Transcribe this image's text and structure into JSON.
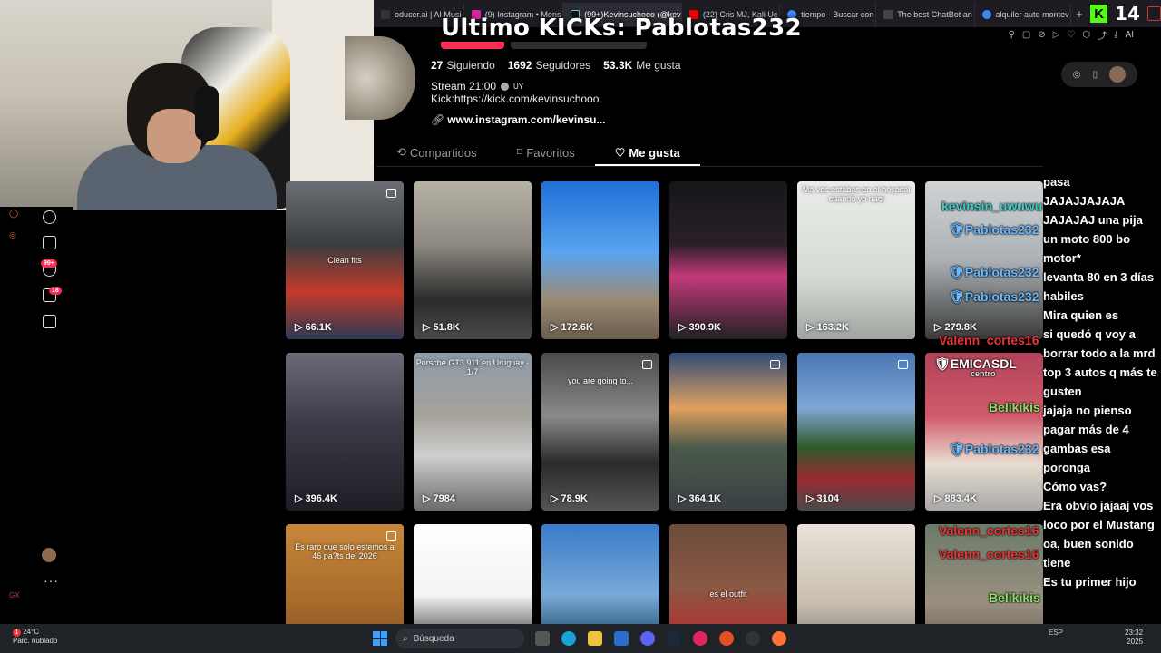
{
  "browser": {
    "tabs": [
      {
        "label": "oducer.ai | AI Musi",
        "color": "#333"
      },
      {
        "label": "(9) Instagram • Mens",
        "color": "#d6249f"
      },
      {
        "label": "(99+)Kevinsuchooo (@kev",
        "color": "#111"
      },
      {
        "label": "(22) Cris MJ, Kali Uc",
        "color": "#e00"
      },
      {
        "label": "tiempo - Buscar con",
        "color": "#4285f4"
      },
      {
        "label": "The best ChatBot an",
        "color": "#444"
      },
      {
        "label": "alquiler auto montev",
        "color": "#4285f4"
      }
    ],
    "new_tab": "+",
    "ai_label": "AI"
  },
  "stream": {
    "kick_logo": "K",
    "viewer_count": "14",
    "overlay_title": "Ultimo KICKs: Pablotas232"
  },
  "profile": {
    "following_count": "27",
    "following_label": "Siguiendo",
    "followers_count": "1692",
    "followers_label": "Seguidores",
    "likes_count": "53.3K",
    "likes_label": "Me gusta",
    "bio_line1": "Stream 21:00",
    "bio_country": "UY",
    "bio_line2": "Kick:https://kick.com/kevinsuchooo",
    "link": "www.instagram.com/kevinsu..."
  },
  "profile_tabs": [
    {
      "label": "Compartidos",
      "icon": "⟲"
    },
    {
      "label": "Favoritos",
      "icon": "⌑"
    },
    {
      "label": "Me gusta",
      "icon": "♡"
    }
  ],
  "sidebar": {
    "messages_badge": "99+",
    "inbox_badge": "18"
  },
  "videos": [
    {
      "views": "66.1K",
      "overlay": "Clean fits",
      "pinned": true,
      "bg": "linear-gradient(180deg,#6b6f74 0%,#3a3d40 40%,#c43a2a 70%,#2e3a55 100%)"
    },
    {
      "views": "51.8K",
      "overlay": "",
      "pinned": false,
      "bg": "linear-gradient(180deg,#b7b2a6 0%,#8e8a82 40%,#2b2b2b 75%,#4a4a4a 100%)"
    },
    {
      "views": "172.6K",
      "overlay": "",
      "pinned": false,
      "bg": "linear-gradient(180deg,#1f6fd6 0%,#5aa4ef 45%,#9b8b74 75%,#6b5d4c 100%)"
    },
    {
      "views": "390.9K",
      "overlay": "",
      "pinned": false,
      "bg": "linear-gradient(180deg,#16161a 0%,#2a1f28 40%,#c23a7a 60%,#222 100%)"
    },
    {
      "views": "163.2K",
      "overlay": "Ma vos estabas en el hospital cuando yo naci",
      "pinned": false,
      "bg": "linear-gradient(180deg,#e9ece8 0%,#d7dbd6 60%,#9fa4a0 100%)"
    },
    {
      "views": "279.8K",
      "overlay": "",
      "pinned": false,
      "bg": "linear-gradient(180deg,#cfd3d6 0%,#aab0b4 50%,#3a3a3a 100%)"
    },
    {
      "views": "396.4K",
      "overlay": "",
      "pinned": false,
      "bg": "linear-gradient(180deg,#6b6a78 0%,#3b3a46 45%,#1e1e26 100%)"
    },
    {
      "views": "7984",
      "overlay": "Porsche GT3 911 en Uruguay · 1/7",
      "pinned": false,
      "bg": "linear-gradient(180deg,#8d9aa8 0%,#a6a39c 40%,#cfcfcf 65%,#6c6c6c 100%)"
    },
    {
      "views": "78.9K",
      "overlay": "you are going to...",
      "pinned": true,
      "bg": "linear-gradient(180deg,#4a4a4a 0%,#8a8a8a 40%,#2a2a2a 70%,#555 100%)"
    },
    {
      "views": "364.1K",
      "overlay": "",
      "pinned": true,
      "bg": "linear-gradient(180deg,#2f4c78 0%,#e0a060 35%,#4a5a4a 60%,#3a3f45 100%)"
    },
    {
      "views": "3104",
      "overlay": "",
      "pinned": true,
      "bg": "linear-gradient(180deg,#4a78b5 0%,#7fa6d4 35%,#2e5a2a 60%,#9a2a30 80%,#4a4a4a 100%)"
    },
    {
      "views": "883.4K",
      "overlay": "",
      "pinned": false,
      "bg": "linear-gradient(180deg,#b3435a 0%,#d05a6a 40%,#e8ddd0 70%,#a8a8a8 100%)"
    },
    {
      "views": "",
      "overlay": "Es raro que solo estemos a 46 pa?ts del 2026",
      "pinned": true,
      "bg": "linear-gradient(180deg,#c8883a 0%,#a66a2a 50%,#6b4626 100%)"
    },
    {
      "views": "",
      "overlay": "",
      "pinned": false,
      "bg": "linear-gradient(180deg,#ffffff 0%,#f4f4f4 45%,#2a2a2a 80%,#1a1a1a 100%)"
    },
    {
      "views": "",
      "overlay": "",
      "pinned": false,
      "bg": "linear-gradient(180deg,#3a7bc8 0%,#79a9d8 45%,#2c5a7a 70%,#1e3a50 100%)"
    },
    {
      "views": "",
      "overlay": "es el outfit",
      "pinned": false,
      "bg": "linear-gradient(180deg,#6b4a3a 0%,#8a5a44 40%,#b03030 70%,#2a2a2a 100%)"
    },
    {
      "views": "",
      "overlay": "",
      "pinned": false,
      "bg": "linear-gradient(180deg,#e8e2d8 0%,#c8beb0 50%,#4a4a44 100%)"
    },
    {
      "views": "",
      "overlay": "",
      "pinned": false,
      "bg": "linear-gradient(180deg,#6b7a6a 0%,#9a9080 50%,#3a3030 100%)"
    }
  ],
  "chat": {
    "messages": [
      "pasa",
      "JAJAJJAJAJA",
      "JAJAJAJ una pija",
      "un moto 800 bo",
      "motor*",
      "levanta 80 en 3 días",
      "habiles",
      "Mira quien es",
      "si quedó q voy a",
      "borrar todo a la mrd",
      "top 3 autos q más te",
      "gusten",
      "jajaja no pienso",
      "pagar más de 4",
      "gambas esa",
      "poronga",
      "Cómo vas?",
      "Era obvio jajaaj vos",
      "loco por el Mustang",
      "oa, buen sonido",
      "tiene",
      "Es tu primer hijo"
    ],
    "usernames": {
      "kevinsin": "kevinsin_uwuwu",
      "pablotas": "Pablotas232",
      "valenn": "Valenn_cortes16",
      "emicasdl": "EMICASDL",
      "centro": "centro",
      "belikikis": "Belikikis"
    }
  },
  "taskbar": {
    "temp": "24°C",
    "weather": "Parc. nublado",
    "weather_badge": "1",
    "search_placeholder": "Búsqueda",
    "lang": "ESP",
    "time": "23:32",
    "date": "2025"
  }
}
